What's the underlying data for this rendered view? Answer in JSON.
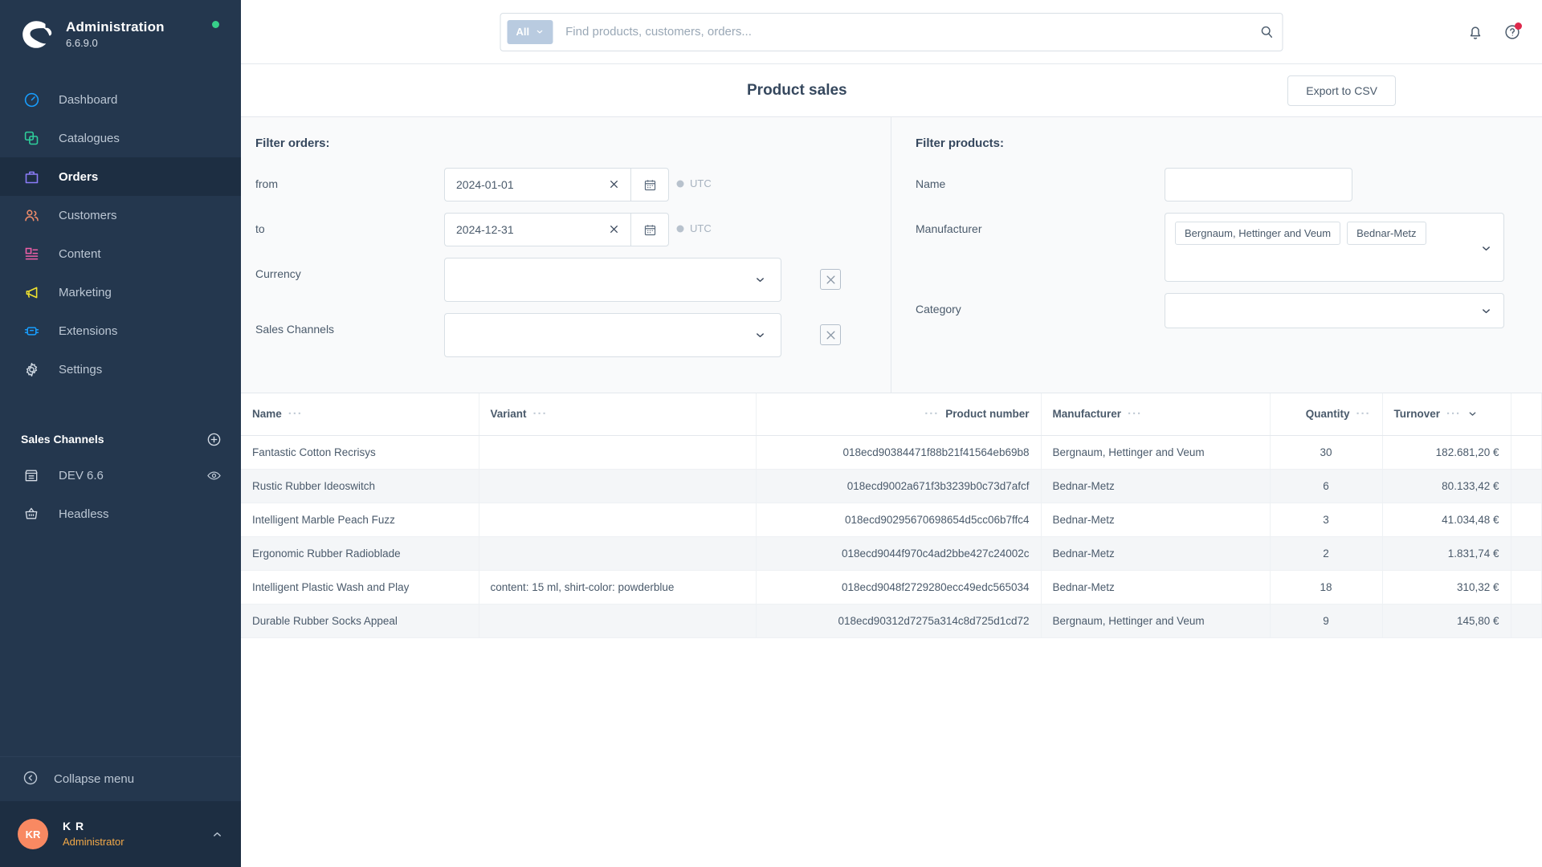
{
  "sidebar": {
    "brand": {
      "title": "Administration",
      "version": "6.6.9.0",
      "logo_icon": "shopware-logo"
    },
    "nav": [
      {
        "label": "Dashboard",
        "icon": "dashboard-icon",
        "color": "#189eff",
        "active": false
      },
      {
        "label": "Catalogues",
        "icon": "catalogues-icon",
        "color": "#2ecf9b",
        "active": false
      },
      {
        "label": "Orders",
        "icon": "orders-icon",
        "color": "#8b7cf8",
        "active": true
      },
      {
        "label": "Customers",
        "icon": "customers-icon",
        "color": "#f08c6a",
        "active": false
      },
      {
        "label": "Content",
        "icon": "content-icon",
        "color": "#ee5fa7",
        "active": false
      },
      {
        "label": "Marketing",
        "icon": "marketing-icon",
        "color": "#f0e22e",
        "active": false
      },
      {
        "label": "Extensions",
        "icon": "extensions-icon",
        "color": "#189eff",
        "active": false
      },
      {
        "label": "Settings",
        "icon": "gear-icon",
        "color": "#cdd6e0",
        "active": false
      }
    ],
    "sales_channels": {
      "title": "Sales Channels",
      "add_icon": "plus-circle-icon",
      "items": [
        {
          "label": "DEV 6.6",
          "icon": "storefront-icon",
          "trailing_icon": "eye-icon"
        },
        {
          "label": "Headless",
          "icon": "basket-icon",
          "trailing_icon": ""
        }
      ]
    },
    "collapse": {
      "label": "Collapse menu",
      "icon": "collapse-left-icon"
    },
    "user": {
      "initials": "KR",
      "name": "K R",
      "role": "Administrator",
      "caret_icon": "chevron-up-icon",
      "avatar_color": "#f88962"
    }
  },
  "topbar": {
    "search": {
      "scope_label": "All",
      "scope_caret_icon": "chevron-down-icon",
      "placeholder": "Find products, customers, orders...",
      "value": "",
      "search_icon": "search-icon"
    },
    "notifications_icon": "bell-icon",
    "help_icon": "help-circle-icon",
    "help_badge": true
  },
  "page": {
    "title": "Product sales",
    "export_label": "Export to CSV"
  },
  "filter_orders": {
    "title": "Filter orders:",
    "from": {
      "label": "from",
      "value": "2024-01-01",
      "clear_icon": "close-icon",
      "calendar_icon": "calendar-icon",
      "timezone": "UTC",
      "clock_icon": "clock-icon"
    },
    "to": {
      "label": "to",
      "value": "2024-12-31",
      "clear_icon": "close-icon",
      "calendar_icon": "calendar-icon",
      "timezone": "UTC",
      "clock_icon": "clock-icon"
    },
    "currency": {
      "label": "Currency",
      "value": "",
      "caret_icon": "chevron-down-icon",
      "clear_icon": "close-icon"
    },
    "sales_channels": {
      "label": "Sales Channels",
      "value": "",
      "caret_icon": "chevron-down-icon",
      "clear_icon": "close-icon"
    }
  },
  "filter_products": {
    "title": "Filter products:",
    "name": {
      "label": "Name",
      "value": "",
      "placeholder": ""
    },
    "manufacturer": {
      "label": "Manufacturer",
      "chips": [
        "Bergnaum, Hettinger and Veum",
        "Bednar-Metz"
      ],
      "caret_icon": "chevron-down-icon"
    },
    "category": {
      "label": "Category",
      "value": "",
      "caret_icon": "chevron-down-icon"
    }
  },
  "table": {
    "columns": [
      {
        "key": "name",
        "label": "Name",
        "align": "left",
        "menu_icon": "column-menu-icon",
        "sorted": false
      },
      {
        "key": "variant",
        "label": "Variant",
        "align": "left",
        "menu_icon": "column-menu-icon",
        "sorted": false
      },
      {
        "key": "product_number",
        "label": "Product number",
        "align": "right",
        "menu_icon": "column-menu-icon",
        "sorted": false
      },
      {
        "key": "manufacturer",
        "label": "Manufacturer",
        "align": "left",
        "menu_icon": "column-menu-icon",
        "sorted": false
      },
      {
        "key": "quantity",
        "label": "Quantity",
        "align": "right",
        "menu_icon": "column-menu-icon",
        "sorted": false
      },
      {
        "key": "turnover",
        "label": "Turnover",
        "align": "right",
        "menu_icon": "column-menu-icon",
        "sorted": true,
        "sort_icon": "chevron-down-icon"
      }
    ],
    "rows": [
      {
        "name": "Fantastic Cotton Recrisys",
        "variant": "",
        "product_number": "018ecd90384471f88b21f41564eb69b8",
        "manufacturer": "Bergnaum, Hettinger and Veum",
        "quantity": "30",
        "turnover": "182.681,20 €"
      },
      {
        "name": "Rustic Rubber Ideoswitch",
        "variant": "",
        "product_number": "018ecd9002a671f3b3239b0c73d7afcf",
        "manufacturer": "Bednar-Metz",
        "quantity": "6",
        "turnover": "80.133,42 €"
      },
      {
        "name": "Intelligent Marble Peach Fuzz",
        "variant": "",
        "product_number": "018ecd90295670698654d5cc06b7ffc4",
        "manufacturer": "Bednar-Metz",
        "quantity": "3",
        "turnover": "41.034,48 €"
      },
      {
        "name": "Ergonomic Rubber Radioblade",
        "variant": "",
        "product_number": "018ecd9044f970c4ad2bbe427c24002c",
        "manufacturer": "Bednar-Metz",
        "quantity": "2",
        "turnover": "1.831,74 €"
      },
      {
        "name": "Intelligent Plastic Wash and Play",
        "variant": "content: 15 ml, shirt-color: powderblue",
        "product_number": "018ecd9048f2729280ecc49edc565034",
        "manufacturer": "Bednar-Metz",
        "quantity": "18",
        "turnover": "310,32 €"
      },
      {
        "name": "Durable Rubber Socks Appeal",
        "variant": "",
        "product_number": "018ecd90312d7275a314c8d725d1cd72",
        "manufacturer": "Bergnaum, Hettinger and Veum",
        "quantity": "9",
        "turnover": "145,80 €"
      }
    ]
  },
  "colors": {
    "sidebar_bg": "#24374e",
    "sidebar_active": "#1d2e42",
    "accent_orange": "#f3a948",
    "badge_red": "#de294c",
    "status_green": "#37d08a"
  }
}
